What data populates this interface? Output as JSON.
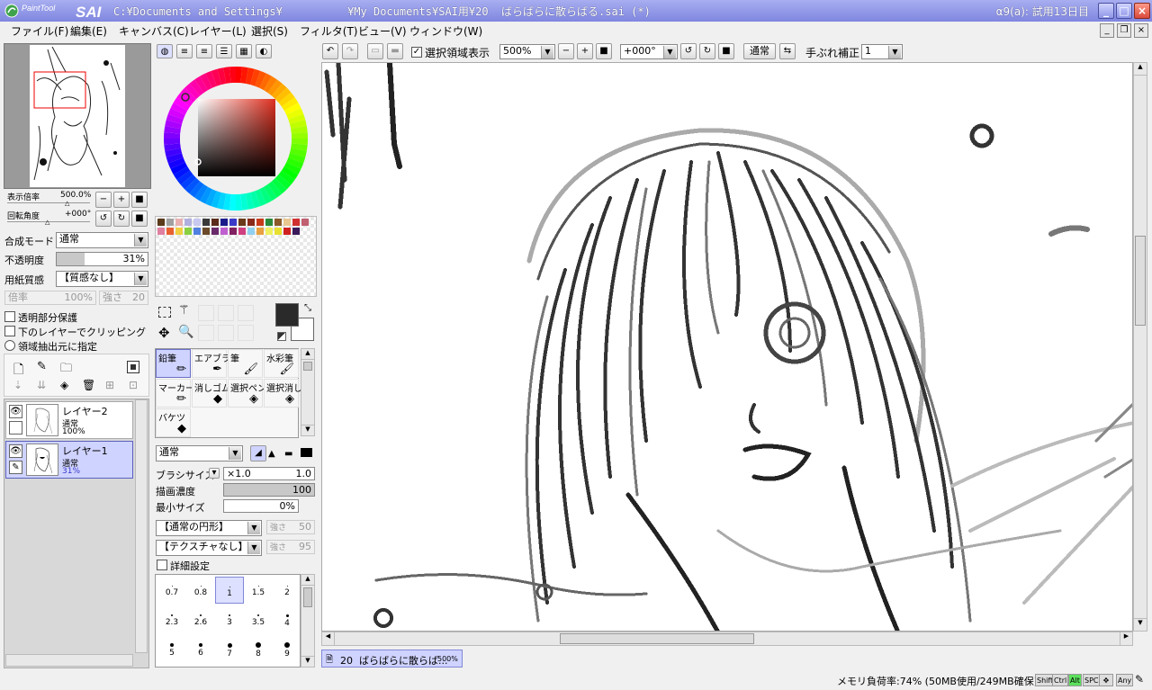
{
  "titlebar": {
    "app_logo": "PaintTool SAI",
    "path": "C:¥Documents and Settings¥          ¥My Documents¥SAI用¥20  ばらばらに散らばる.sai (*)",
    "trial": "α9(a): 試用13日目",
    "min_icon": "minimize-icon",
    "max_icon": "maximize-icon",
    "close_icon": "close-icon"
  },
  "menu": [
    "ファイル(F)",
    "編集(E)",
    "キャンバス(C)",
    "レイヤー(L)",
    "選択(S)",
    "フィルタ(T)",
    "ビュー(V)",
    "ウィンドウ(W)"
  ],
  "navigator": {
    "zoom_label": "表示倍率",
    "zoom_value": "500.0%",
    "rotate_label": "回転角度",
    "rotate_value": "+000°"
  },
  "layer_props": {
    "blend_label": "合成モード",
    "blend_value": "通常",
    "opacity_label": "不透明度",
    "opacity_value": "31%",
    "opacity_fraction": 0.31,
    "paper_label": "用紙質感",
    "paper_value": "【質感なし】",
    "scale_label": "倍率",
    "scale_value": "100%",
    "strength_label": "強さ",
    "strength_value": "20",
    "check1": "透明部分保護",
    "check2": "下のレイヤーでクリッピング",
    "check3": "領域抽出元に指定"
  },
  "layers": [
    {
      "name": "レイヤー2",
      "mode": "通常",
      "opacity": "100%"
    },
    {
      "name": "レイヤー1",
      "mode": "通常",
      "opacity": "31%"
    }
  ],
  "palette": {
    "colors": [
      "#5a3a1a",
      "#a0a0a0",
      "#e8b0b0",
      "#b0b0e0",
      "#c8c8f0",
      "#3a3a3a",
      "#5a2a1a",
      "#1a1a8a",
      "#3a3ac8",
      "#6a3a1a",
      "#8a2a1a",
      "#c83a1a",
      "#2a8a3a",
      "#8a5a2a",
      "#e8c890",
      "#d03030",
      "#c06070",
      "#e080a0",
      "#e86030",
      "#f0d040",
      "#8ad040",
      "#5080e0",
      "#6a4a2a",
      "#6a2a6a",
      "#c060d0",
      "#802060",
      "#d04080",
      "#90d0f0",
      "#e8a040",
      "#f0f060",
      "#e8e030",
      "#d02020",
      "#3a1a5a"
    ],
    "primary": "#2a2a2a",
    "secondary": "#ffffff"
  },
  "tools": [
    {
      "name": "鉛筆",
      "icon": "pencil-icon",
      "selected": true
    },
    {
      "name": "エアブラシ",
      "icon": "airbrush-icon",
      "selected": false
    },
    {
      "name": "筆",
      "icon": "brush-icon",
      "selected": false
    },
    {
      "name": "水彩筆",
      "icon": "watercolor-icon",
      "selected": false
    },
    {
      "name": "マーカー",
      "icon": "marker-icon",
      "selected": false
    },
    {
      "name": "消しゴム",
      "icon": "eraser-icon",
      "selected": false
    },
    {
      "name": "選択ペン",
      "icon": "select-pen-icon",
      "selected": false
    },
    {
      "name": "選択消し",
      "icon": "select-erase-icon",
      "selected": false
    },
    {
      "name": "バケツ",
      "icon": "bucket-icon",
      "selected": false
    }
  ],
  "brush": {
    "mode": "通常",
    "size_label": "ブラシサイズ",
    "size_mult": "×1.0",
    "size_value": "1.0",
    "density_label": "描画濃度",
    "density_value": "100",
    "density_fraction": 1.0,
    "min_label": "最小サイズ",
    "min_value": "0%",
    "shape": "【通常の円形】",
    "shape_strength_label": "強さ",
    "shape_strength": "50",
    "texture": "【テクスチャなし】",
    "texture_strength_label": "強さ",
    "texture_strength": "95",
    "detail_label": "詳細設定",
    "sizes": [
      "0.7",
      "0.8",
      "1",
      "1.5",
      "2",
      "2.3",
      "2.6",
      "3",
      "3.5",
      "4",
      "5",
      "6",
      "7",
      "8",
      "9"
    ],
    "selected_size": "1"
  },
  "canvas_toolbar": {
    "selection_show": "選択領域表示",
    "zoom": "500%",
    "angle": "+000°",
    "blend": "通常",
    "stabilizer_label": "手ぶれ補正",
    "stabilizer_value": "1"
  },
  "doc_tab": {
    "name": "20  ばらばらに散らば...",
    "zoom": "500%"
  },
  "status": {
    "memory": "メモリ負荷率:74% (50MB使用/249MB確保)",
    "keys": [
      "Shift",
      "Ctrl",
      "Alt",
      "SPC",
      "Any"
    ]
  }
}
